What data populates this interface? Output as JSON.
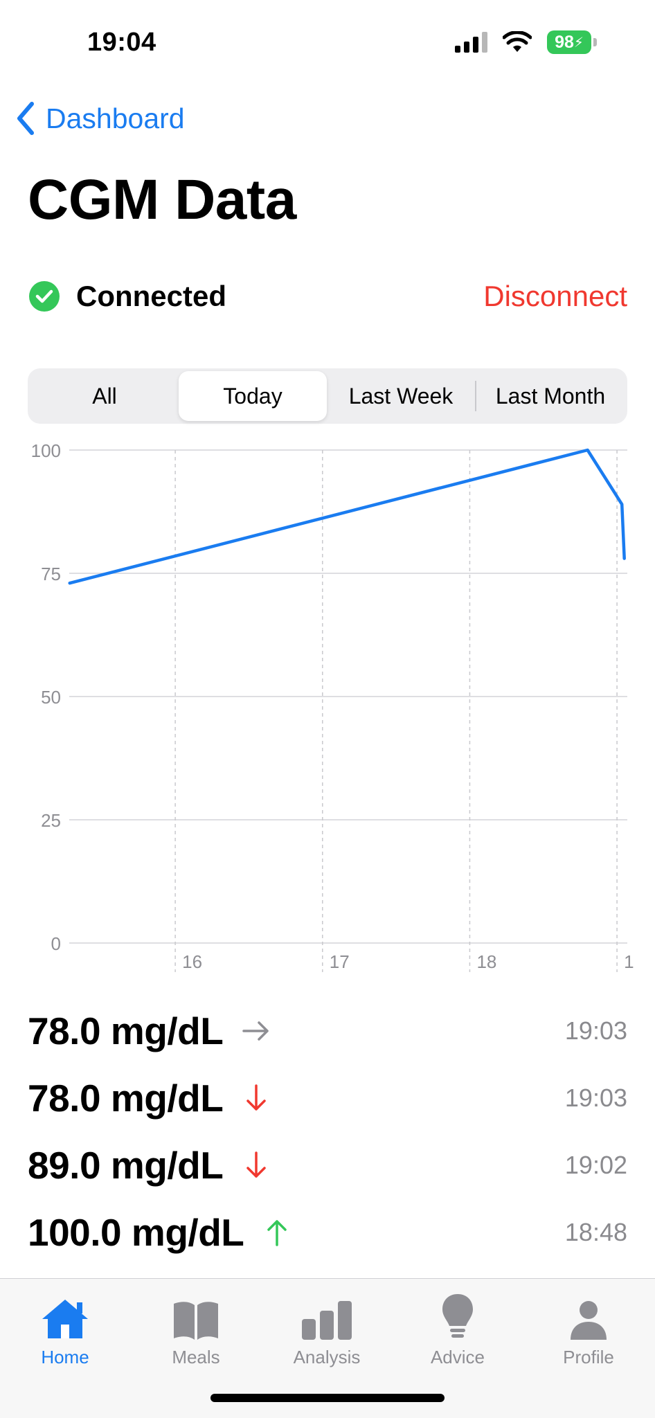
{
  "status_bar": {
    "time": "19:04",
    "battery": "98"
  },
  "nav": {
    "back_label": "Dashboard"
  },
  "page": {
    "title": "CGM Data"
  },
  "connection": {
    "status": "Connected",
    "action": "Disconnect"
  },
  "segments": [
    {
      "label": "All",
      "active": false
    },
    {
      "label": "Today",
      "active": true
    },
    {
      "label": "Last Week",
      "active": false
    },
    {
      "label": "Last Month",
      "active": false
    }
  ],
  "chart_data": {
    "type": "line",
    "ylim": [
      0,
      100
    ],
    "yticks": [
      "0",
      "25",
      "50",
      "75",
      "100"
    ],
    "xticks": [
      "16",
      "17",
      "18",
      "1"
    ],
    "xlim_hours": [
      15.28,
      19.07
    ],
    "series": [
      {
        "color": "#1a7cf0",
        "points": [
          {
            "x": "15:17",
            "y": 73
          },
          {
            "x": "18:48",
            "y": 100
          },
          {
            "x": "19:02",
            "y": 89
          },
          {
            "x": "19:03",
            "y": 78
          }
        ]
      }
    ],
    "grid": true
  },
  "readings": [
    {
      "value": "78.0 mg/dL",
      "trend": "steady",
      "trend_color": "#8e8e93",
      "time": "19:03"
    },
    {
      "value": "78.0 mg/dL",
      "trend": "down",
      "trend_color": "#f0382f",
      "time": "19:03"
    },
    {
      "value": "89.0 mg/dL",
      "trend": "down",
      "trend_color": "#f0382f",
      "time": "19:02"
    },
    {
      "value": "100.0 mg/dL",
      "trend": "up",
      "trend_color": "#34c759",
      "time": "18:48"
    }
  ],
  "tabs": [
    {
      "label": "Home",
      "icon": "house-icon",
      "active": true
    },
    {
      "label": "Meals",
      "icon": "book-icon",
      "active": false
    },
    {
      "label": "Analysis",
      "icon": "bar-chart-icon",
      "active": false
    },
    {
      "label": "Advice",
      "icon": "lightbulb-icon",
      "active": false
    },
    {
      "label": "Profile",
      "icon": "person-icon",
      "active": false
    }
  ],
  "colors": {
    "accent": "#1a7cf0",
    "destructive": "#f0382f",
    "success": "#34c759",
    "inactive": "#8e8e93"
  }
}
